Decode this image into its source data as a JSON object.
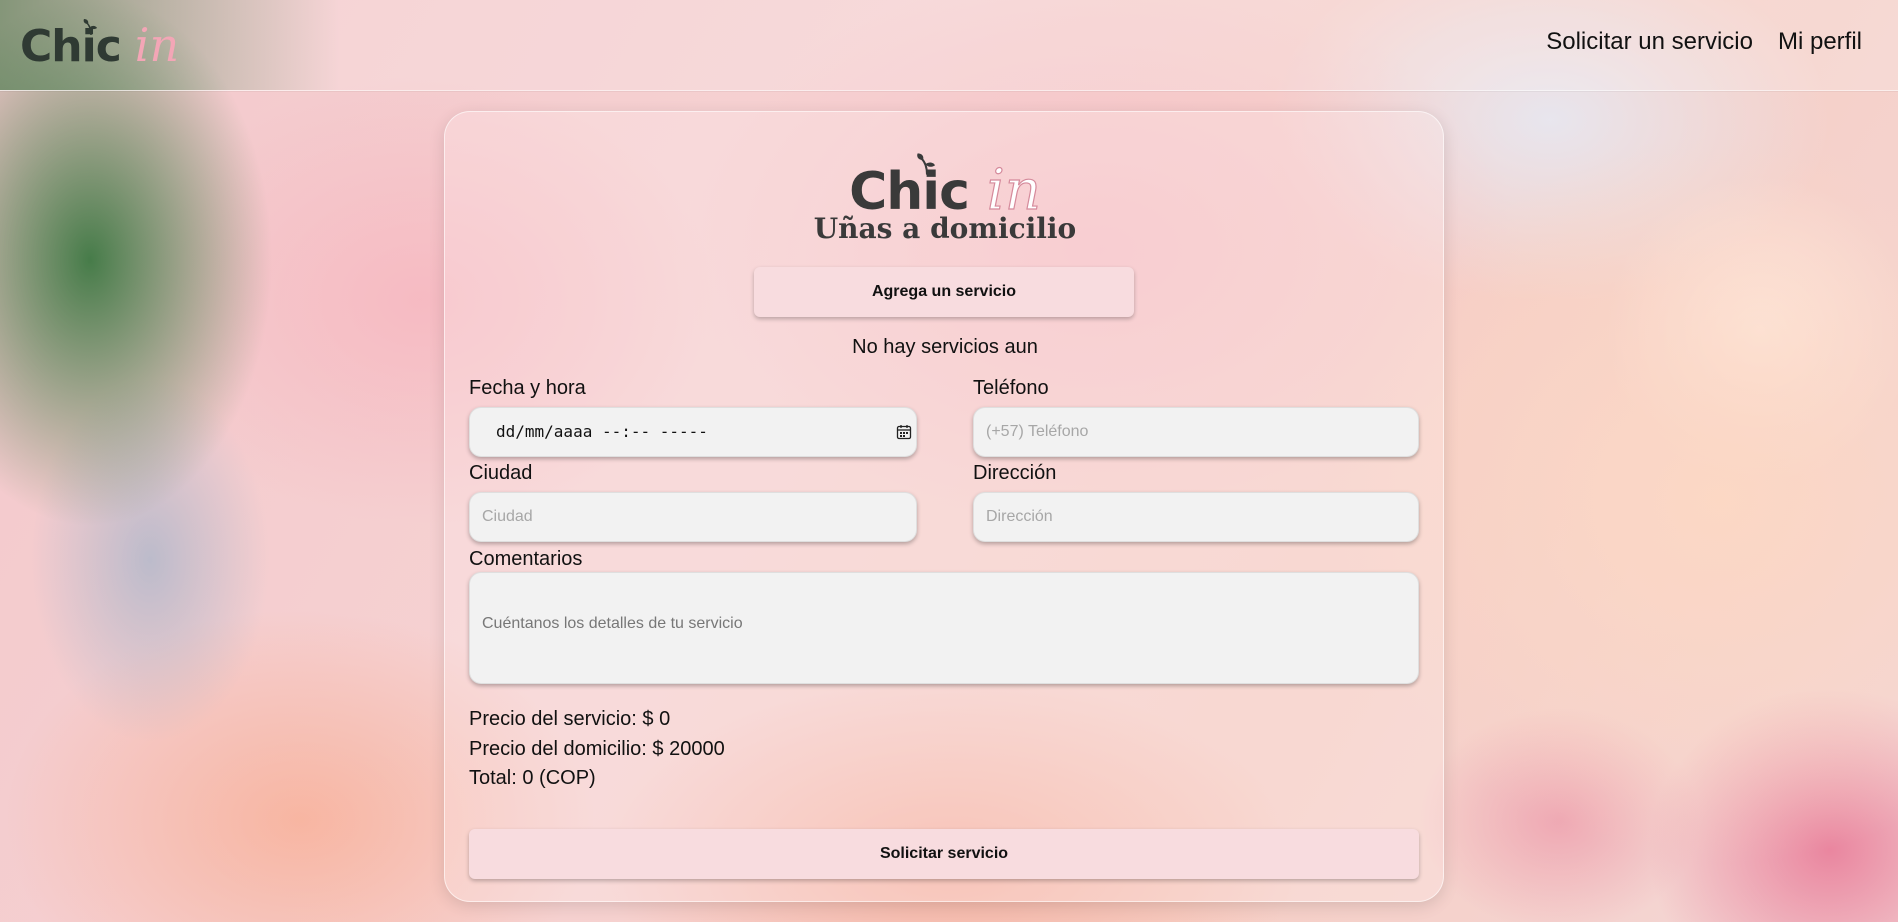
{
  "header": {
    "brand_main": "Chic",
    "brand_accent": "in",
    "nav": [
      {
        "label": "Solicitar un servicio"
      },
      {
        "label": "Mi perfil"
      }
    ]
  },
  "form": {
    "logo_main": "Chic",
    "logo_accent": "in",
    "tagline": "Uñas a domicilio",
    "add_service_label": "Agrega un servicio",
    "no_services_text": "No hay servicios aun",
    "fecha_label": "Fecha y hora",
    "fecha_value_display": "dd/mm/aaaa --:-- -----",
    "telefono_label": "Teléfono",
    "telefono_placeholder": "(+57) Teléfono",
    "ciudad_label": "Ciudad",
    "ciudad_placeholder": "Ciudad",
    "direccion_label": "Dirección",
    "direccion_placeholder": "Dirección",
    "comentarios_label": "Comentarios",
    "comentarios_placeholder": "Cuéntanos los detalles de tu servicio",
    "precio_servicio": "Precio del servicio: $ 0",
    "precio_domicilio": "Precio del domicilio: $ 20000",
    "total": "Total: 0 (COP)",
    "submit_label": "Solicitar servicio"
  },
  "colors": {
    "accent_pink": "#f3a6b6",
    "button_pink": "#f8dcdf",
    "field_bg": "#f2f2f2",
    "logo_dark": "#2f3a33"
  },
  "icons": {
    "brand_leaf": "sprout-icon",
    "datetime_picker": "calendar-icon"
  }
}
